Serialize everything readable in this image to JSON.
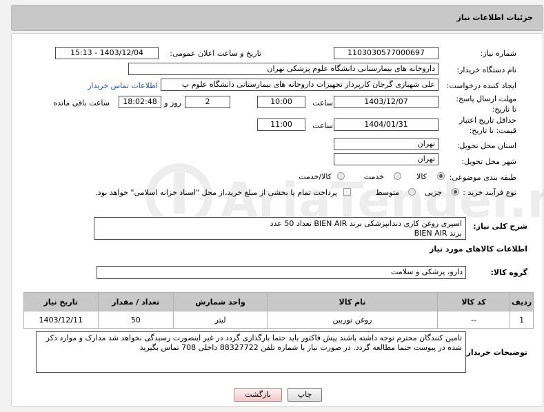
{
  "header": {
    "title": "جزئیات اطلاعات نیاز"
  },
  "need_number": {
    "label": "شماره نیاز:",
    "value": "1103030577000697"
  },
  "announce": {
    "label": "تاریخ و ساعت اعلان عمومی:",
    "value": "1403/12/04 - 15:13"
  },
  "buyer": {
    "label": "نام دستگاه خریدار:",
    "value": "داروخانه های بیمارستانی دانشگاه علوم پزشکی تهران"
  },
  "creator": {
    "label": "ایجاد کننده درخواست:",
    "value": "علی شهبازی گرجان کارپرداز تجهیزات داروخانه های بیمارستانی دانشگاه علوم پ",
    "contact_link": "اطلاعات تماس خریدار"
  },
  "deadline": {
    "label": "مهلت ارسال پاسخ: تا تاریخ:",
    "date": "1403/12/07",
    "time_label": "ساعت",
    "time": "10:00",
    "days": "2",
    "days_label": "روز و",
    "remaining": "18:02:48",
    "remaining_label": "ساعت باقی مانده"
  },
  "validity": {
    "label": "حداقل تاریخ اعتبار قیمت: تا تاریخ:",
    "date": "1404/01/31",
    "time_label": "ساعت",
    "time": "11:00"
  },
  "province": {
    "label": "استان محل تحویل:",
    "value": "تهران"
  },
  "city": {
    "label": "شهر محل تحویل:",
    "value": "تهران"
  },
  "category": {
    "label": "طبقه بندی موضوعی:",
    "options": [
      "کالا",
      "خدمت",
      "کالا/خدمت"
    ],
    "selected": "کالا"
  },
  "process": {
    "label": "نوع فرآیند خرید :",
    "options": [
      "جزیی",
      "متوسط"
    ],
    "selected": "جزیی",
    "note": "پرداخت تمام یا بخشی از مبلغ خرید،از محل \"اسناد خزانه اسلامی\" خواهد بود."
  },
  "description": {
    "label": "شرح کلی نیاز:",
    "value": "اسپری روغن کاری دندانپزشکی برند BIEN AIR تعداد 50 عدد\nبرند BIEN AIR"
  },
  "goods_info": {
    "title": "اطلاعات کالاهای مورد نیاز"
  },
  "goods_group": {
    "label": "گروه کالا:",
    "value": "دارو، پزشکی و سلامت"
  },
  "table": {
    "headers": [
      "ردیف",
      "کد کالا",
      "نام کالا",
      "واحد شمارش",
      "تعداد / مقدار",
      "تاریخ نیاز"
    ],
    "rows": [
      [
        "1",
        "--",
        "روغن توربین",
        "لیتر",
        "50",
        "1403/12/11"
      ]
    ]
  },
  "buyer_notes": {
    "label": "توضیحات خریدار:",
    "value": "تامین کنندگان محترم توجه داشته باشند پیش فاکتور باید حتما بارگذاری گردد در غیر اینصورت رسیدگی نخواهد شد مدارک و موارد ذکر شده در پیوست حتما مطالعه گردد. در صورت نیاز با شماره تلفن 88327722 داخلی 708 تماس بگیرید"
  },
  "buttons": {
    "print": "چاپ",
    "back": "بازگشت"
  },
  "watermark": {
    "text": "AriaTender.neT"
  },
  "colors": {
    "header_bg": "#c8c8c8",
    "link": "#1a4fb5",
    "back_button": "#f2c8c8"
  }
}
